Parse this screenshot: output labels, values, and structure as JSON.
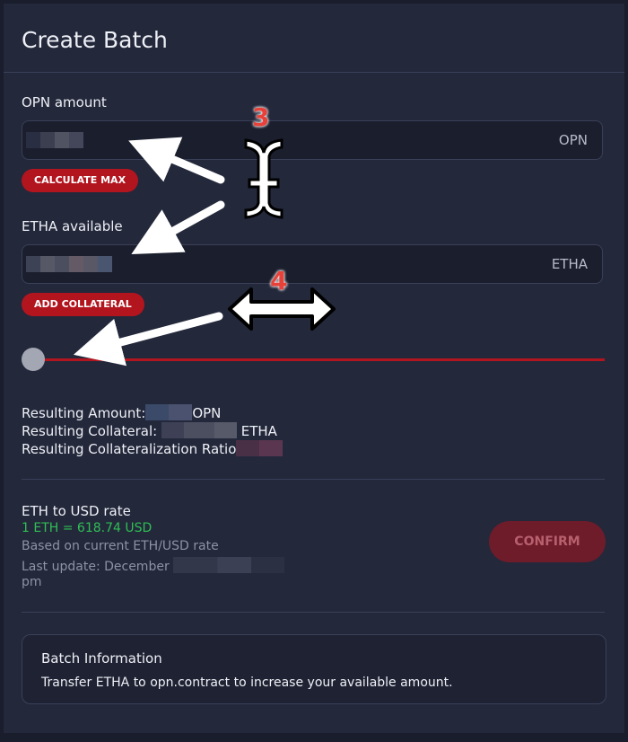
{
  "header": {
    "title": "Create Batch"
  },
  "opn": {
    "label": "OPN amount",
    "unit": "OPN",
    "calc_max_label": "CALCULATE MAX"
  },
  "etha": {
    "label": "ETHA available",
    "unit": "ETHA",
    "add_collateral_label": "ADD COLLATERAL"
  },
  "slider": {
    "value": 0
  },
  "results": {
    "amount_label": "Resulting Amount:",
    "amount_unit": "OPN",
    "collateral_label": "Resulting Collateral:",
    "collateral_unit": "ETHA",
    "ratio_label": "Resulting Collateralization Ratio"
  },
  "rate": {
    "heading": "ETH to USD rate",
    "value": "1 ETH = 618.74 USD",
    "based_on": "Based on current ETH/USD rate",
    "last_update": "Last update: December",
    "pm": "pm"
  },
  "confirm_label": "CONFIRM",
  "batch_info": {
    "title": "Batch Information",
    "text": "Transfer ETHA to opn.contract to increase your available amount."
  },
  "annotations": {
    "step3": "3",
    "step4": "4"
  },
  "colors": {
    "accent": "#b3151f",
    "rate_green": "#2fbf54",
    "panel": "#23283b"
  }
}
